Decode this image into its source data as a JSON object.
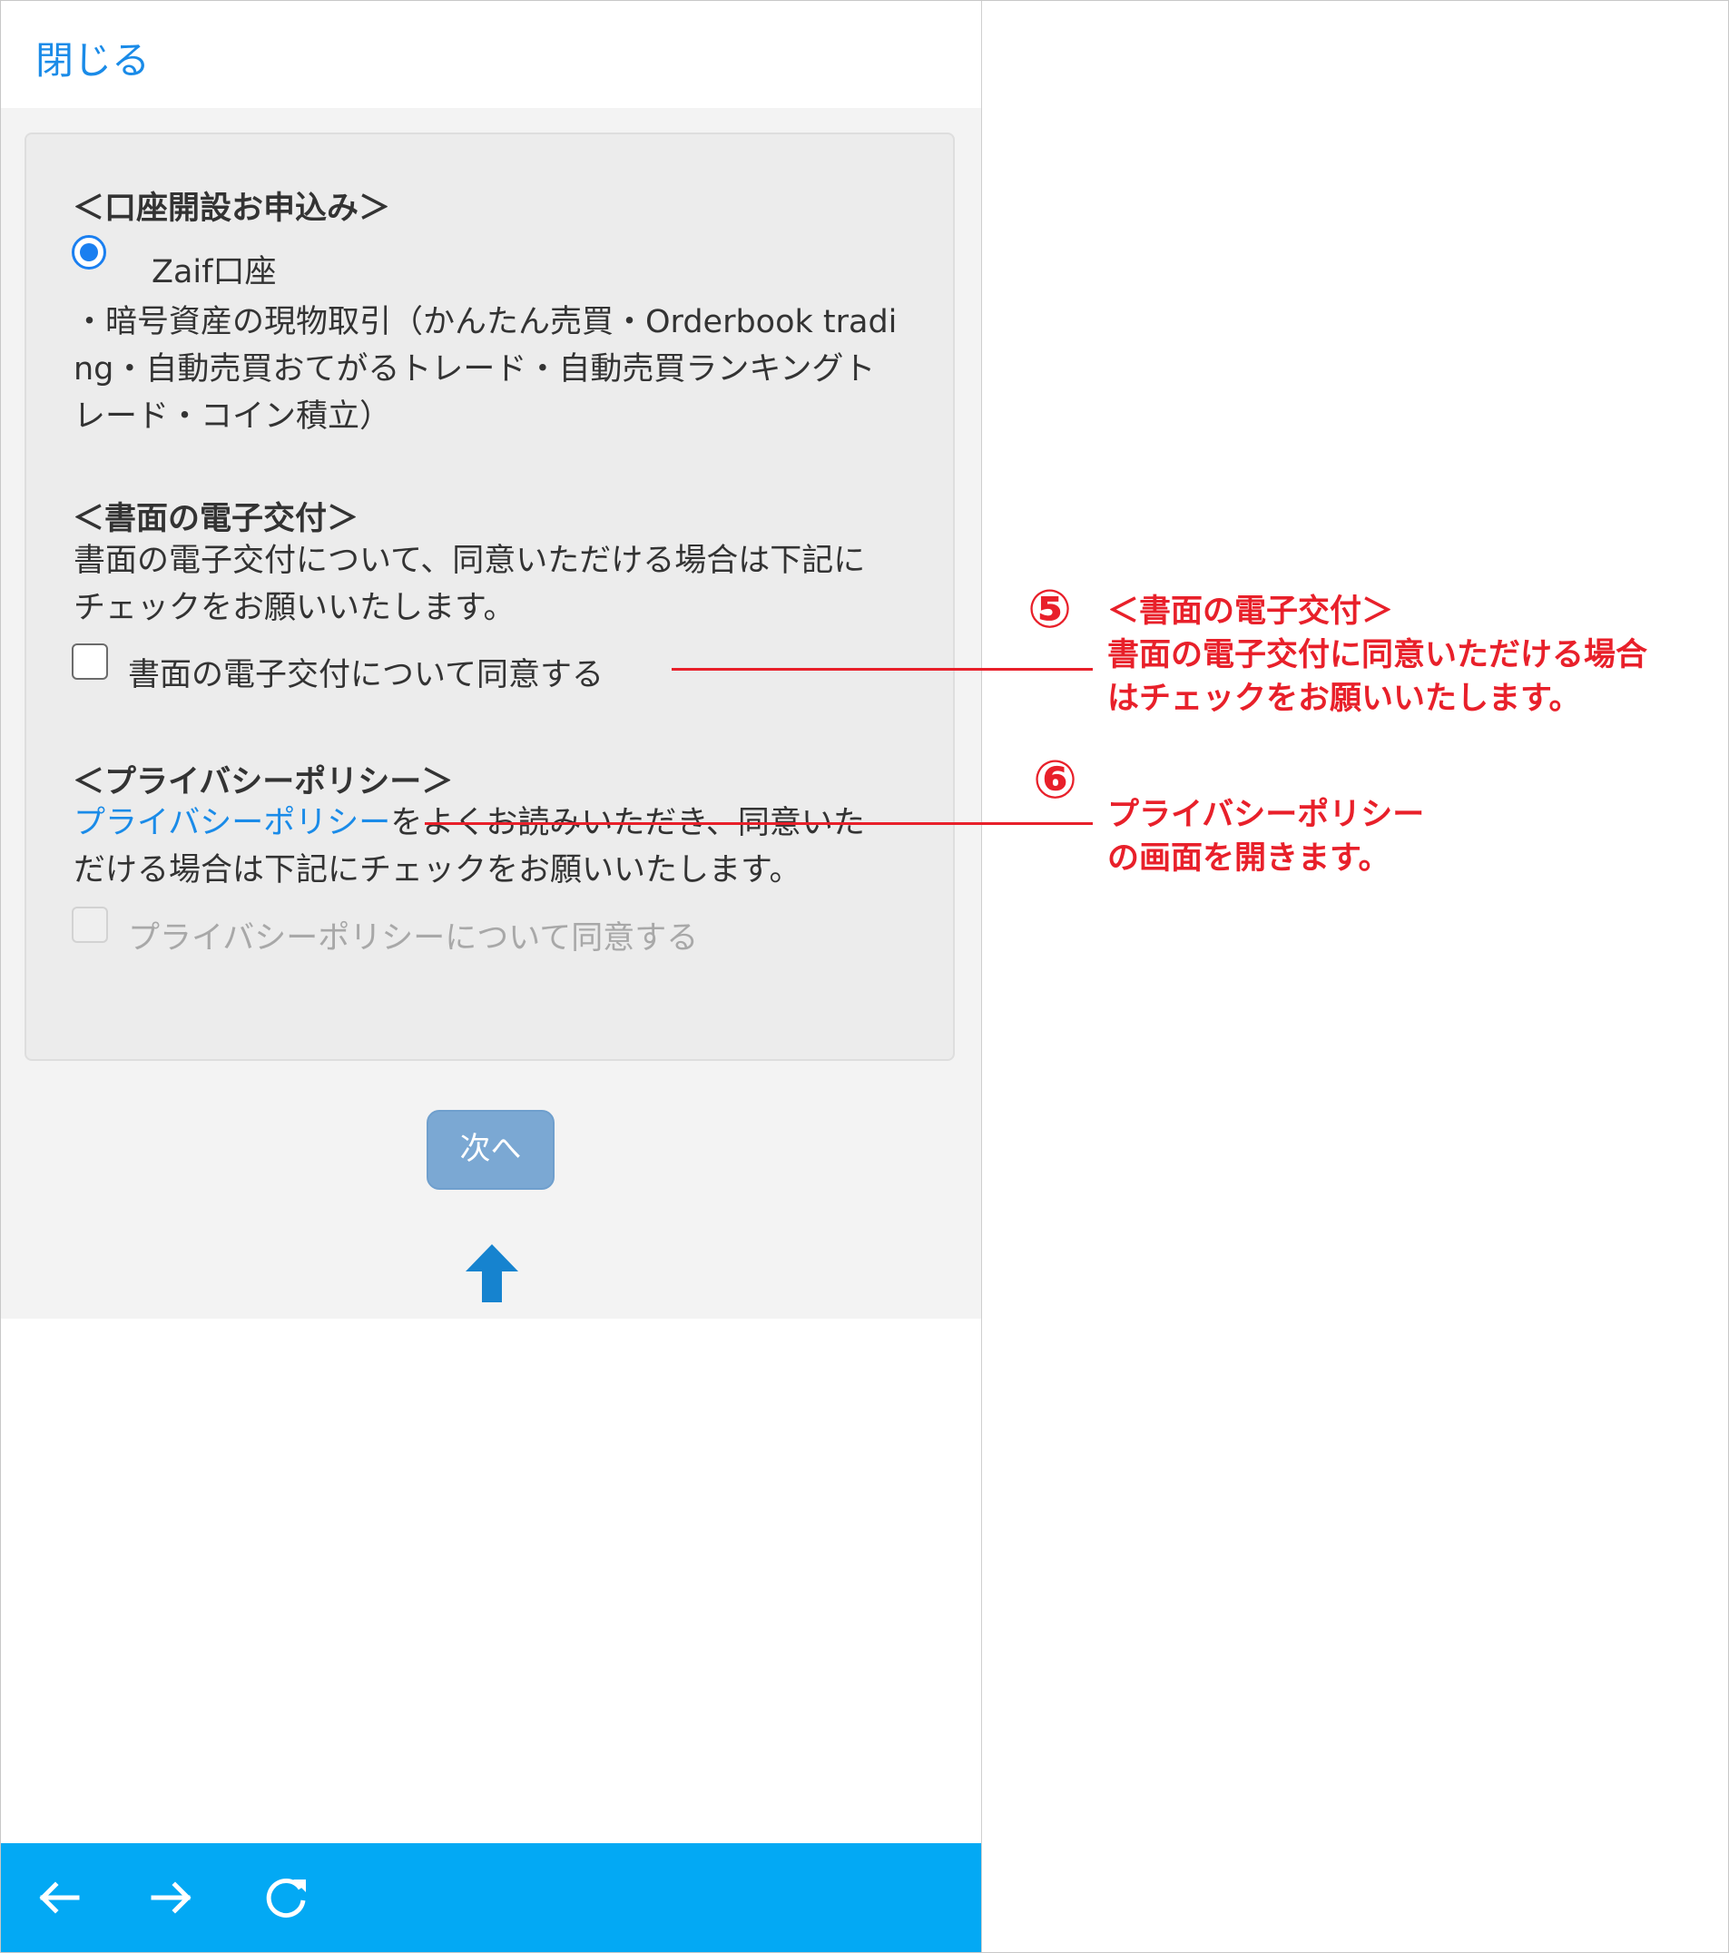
{
  "header": {
    "close_label": "閉じる"
  },
  "account_section": {
    "heading": "＜口座開設お申込み＞",
    "radio_label": "Zaif口座",
    "desc_line1": "・暗号資産の現物取引（かんたん売買・Orderbook tradi",
    "desc_line2": "ng・自動売買おてがるトレード・自動売買ランキングト",
    "desc_line3": "レード・コイン積立）"
  },
  "edelivery_section": {
    "heading": "＜書面の電子交付＞",
    "desc_line1": "書面の電子交付について、同意いただける場合は下記に",
    "desc_line2": "チェックをお願いいたします。",
    "checkbox_label": "書面の電子交付について同意する"
  },
  "privacy_section": {
    "heading": "＜プライバシーポリシー＞",
    "link_text": "プライバシーポリシー",
    "desc_rest": "をよくお読みいただき、同意いた",
    "desc_line2": "だける場合は下記にチェックをお願いいたします。",
    "checkbox_label": "プライバシーポリシーについて同意する"
  },
  "next_button": {
    "label": "次へ"
  },
  "annotations": [
    {
      "number": "⑤",
      "lines": [
        "＜書面の電子交付＞",
        "書面の電子交付に同意いただける場合",
        "はチェックをお願いいたします。"
      ]
    },
    {
      "number": "⑥",
      "lines": [
        "プライバシーポリシー",
        "の画面を開きます。"
      ]
    }
  ],
  "icons": {
    "back": "arrow-left-icon",
    "forward": "arrow-right-icon",
    "reload": "reload-icon",
    "pointer": "arrow-up-icon"
  },
  "colors": {
    "link": "#1a8be8",
    "bottom_bar": "#03a9f4",
    "annotation": "#e8202a",
    "button": "#7ba8d3"
  }
}
